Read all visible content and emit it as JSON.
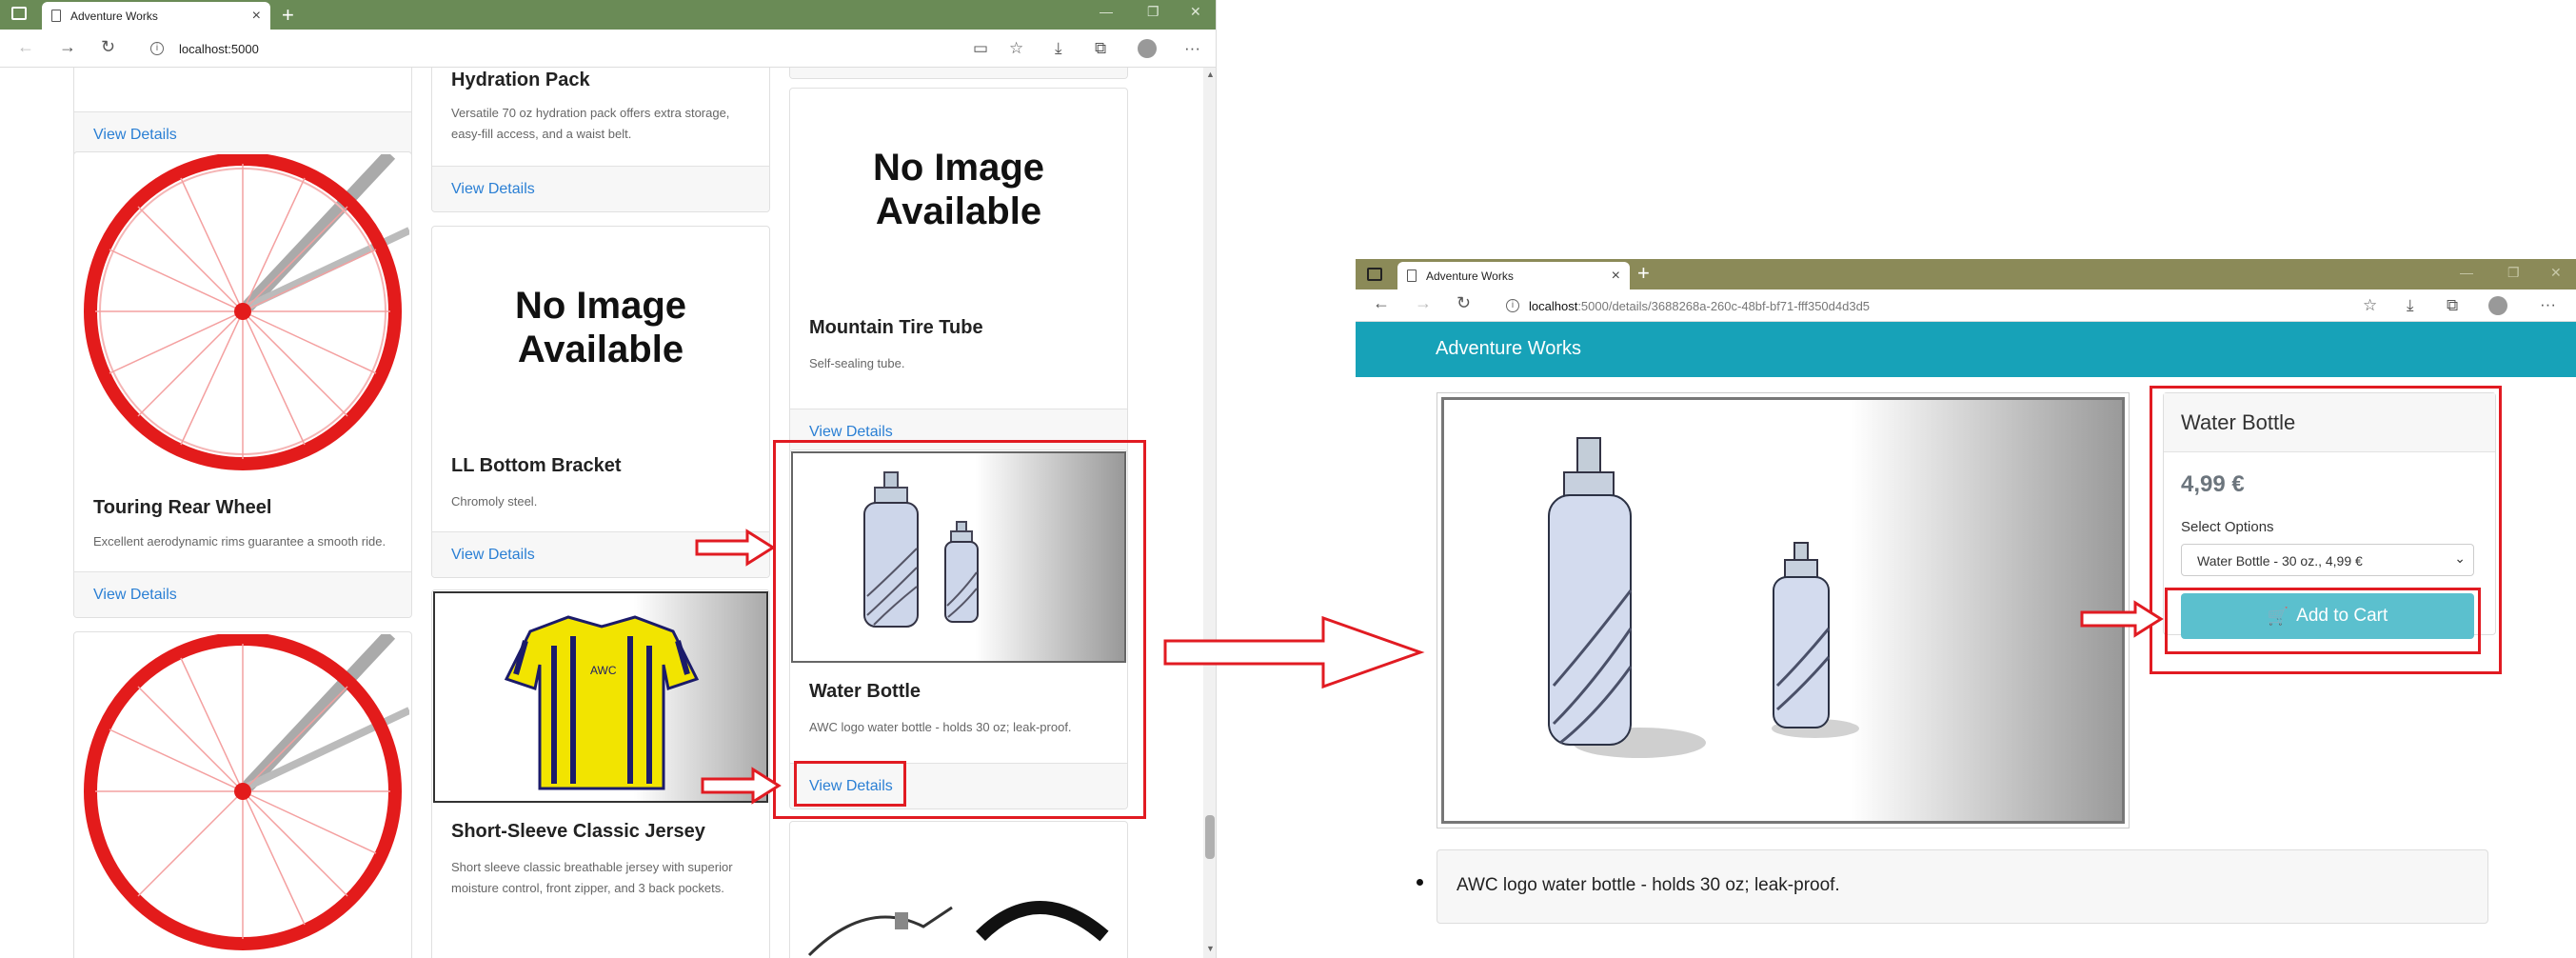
{
  "left_browser": {
    "tab_title": "Adventure Works",
    "url": "localhost:5000",
    "products": {
      "top_partial_link": "View Details",
      "hydration_pack": {
        "name": "Hydration Pack",
        "desc": "Versatile 70 oz hydration pack offers extra storage, easy-fill access, and a waist belt.",
        "link": "View Details"
      },
      "no_image_1": "No Image Available",
      "mountain_tire_tube": {
        "name": "Mountain Tire Tube",
        "desc": "Self-sealing tube.",
        "link": "View Details"
      },
      "touring_rear_wheel": {
        "name": "Touring Rear Wheel",
        "desc": "Excellent aerodynamic rims guarantee a smooth ride.",
        "link": "View Details"
      },
      "no_image_2": "No Image Available",
      "ll_bottom_bracket": {
        "name": "LL Bottom Bracket",
        "desc": "Chromoly steel.",
        "link": "View Details"
      },
      "water_bottle": {
        "name": "Water Bottle",
        "desc": "AWC logo water bottle - holds 30 oz; leak-proof.",
        "link": "View Details"
      },
      "jersey": {
        "name": "Short-Sleeve Classic Jersey",
        "desc": "Short sleeve classic breathable jersey with superior moisture control, front zipper, and 3 back pockets.",
        "jersey_logo": "AWC"
      }
    }
  },
  "right_browser": {
    "tab_title": "Adventure Works",
    "url_host": "localhost",
    "url_path": ":5000/details/3688268a-260c-48bf-bf71-fff350d4d3d5",
    "brand": "Adventure Works",
    "product_title": "Water Bottle",
    "price": "4,99 €",
    "select_label": "Select Options",
    "select_value": "Water Bottle - 30 oz., 4,99 €",
    "add_to_cart": "Add to Cart",
    "description": "AWC logo water bottle - holds 30 oz; leak-proof."
  },
  "colors": {
    "annotation_red": "#e11b22",
    "brand_teal": "#17a2b8",
    "link_blue": "#2a7fd4",
    "cart_button": "#5bc0ce"
  }
}
